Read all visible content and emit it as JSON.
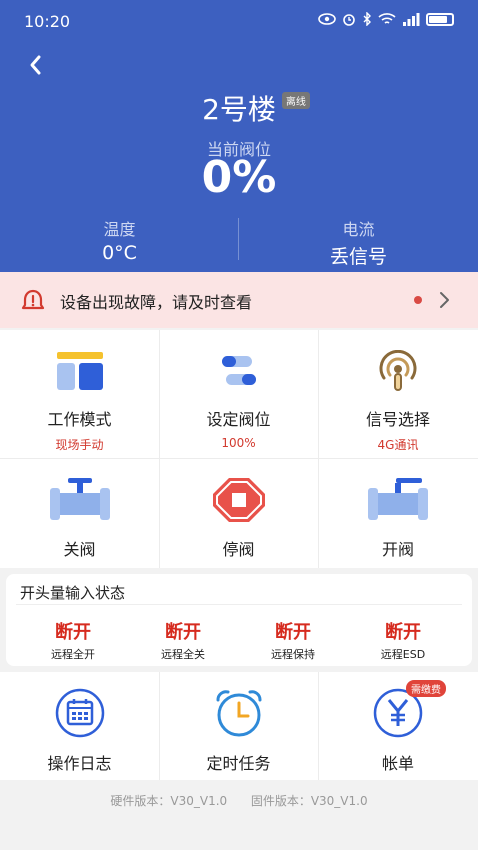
{
  "status_bar": {
    "time": "10:20"
  },
  "header": {
    "title": "2号楼",
    "status_badge": "离线",
    "valve_label": "当前阀位",
    "valve_value": "0%",
    "temperature_label": "温度",
    "temperature_value": "0°C",
    "current_label": "电流",
    "current_value": "丢信号"
  },
  "alert": {
    "text": "设备出现故障，请及时查看"
  },
  "controls_top": [
    {
      "name": "工作模式",
      "sub": "现场手动"
    },
    {
      "name": "设定阀位",
      "sub": "100%"
    },
    {
      "name": "信号选择",
      "sub": "4G通讯"
    }
  ],
  "controls_valve": [
    {
      "name": "关阀"
    },
    {
      "name": "停阀"
    },
    {
      "name": "开阀"
    }
  ],
  "switch_status": {
    "title": "开头量输入状态",
    "items": [
      {
        "state": "断开",
        "label": "远程全开"
      },
      {
        "state": "断开",
        "label": "远程全关"
      },
      {
        "state": "断开",
        "label": "远程保持"
      },
      {
        "state": "断开",
        "label": "远程ESD"
      }
    ]
  },
  "bottom_menu": [
    {
      "name": "操作日志"
    },
    {
      "name": "定时任务"
    },
    {
      "name": "帐单",
      "badge": "需缴费"
    }
  ],
  "footer": {
    "hardware": "硬件版本：V30_V1.0",
    "firmware": "固件版本：V30_V1.0"
  },
  "colors": {
    "header_bg": "#3d60c0",
    "alert_bg": "#fbe4e4",
    "accent_red": "#d23a2f"
  }
}
